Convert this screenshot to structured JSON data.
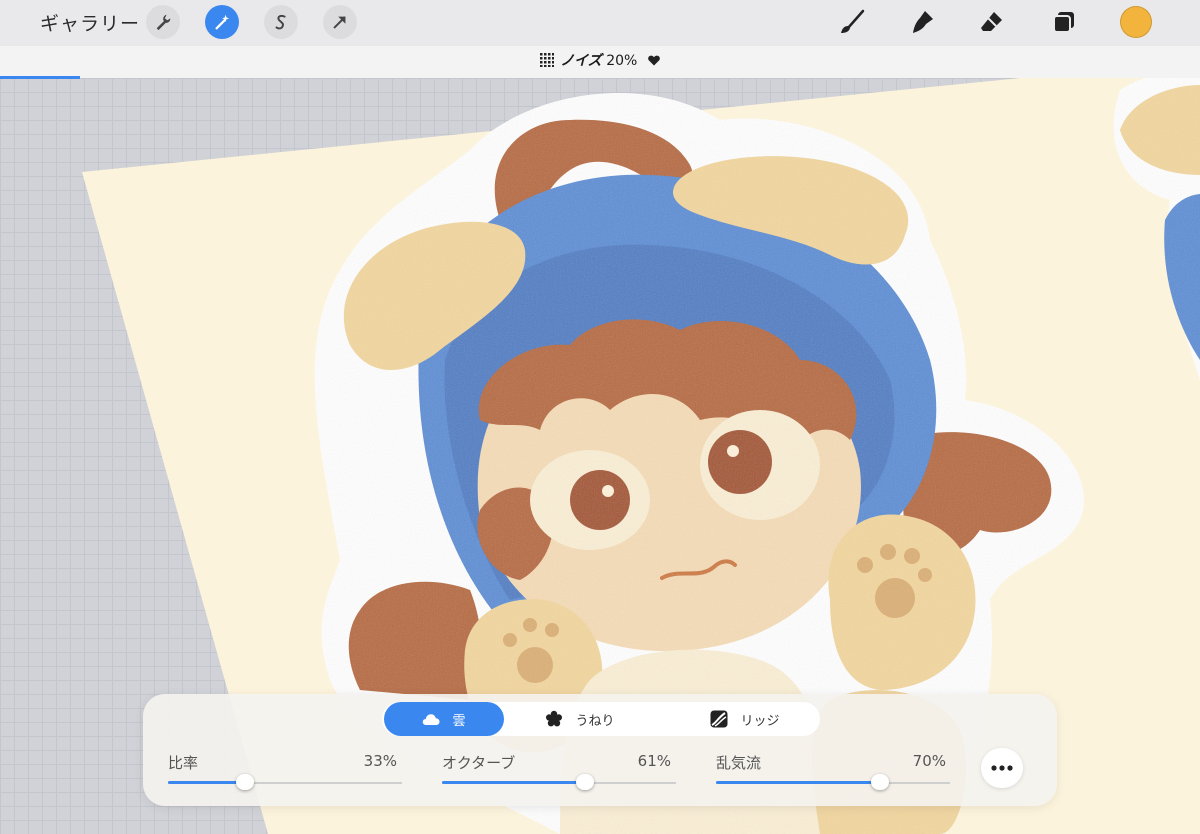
{
  "toolbar": {
    "gallery_label": "ギャラリー",
    "tools": [
      {
        "name": "wrench-icon",
        "active": false
      },
      {
        "name": "magic-wand-icon",
        "active": true
      },
      {
        "name": "selection-s-icon",
        "active": false
      },
      {
        "name": "transform-arrow-icon",
        "active": false
      }
    ],
    "right_tools": [
      "brush-icon",
      "smudge-icon",
      "eraser-icon",
      "layers-icon"
    ],
    "current_color": "#f2b43c"
  },
  "filter": {
    "icon": "noise-grid-icon",
    "name": "ノイズ",
    "value": "20%",
    "dropdown_icon": "heart-dropdown-icon",
    "progress": 0.067
  },
  "segments": [
    {
      "label": "雲",
      "icon": "cloud-icon",
      "active": true
    },
    {
      "label": "うねり",
      "icon": "billow-flower-icon",
      "active": false
    },
    {
      "label": "リッジ",
      "icon": "ridge-icon",
      "active": false
    }
  ],
  "sliders": [
    {
      "label": "比率",
      "value": "33%",
      "fraction": 0.33
    },
    {
      "label": "オクターブ",
      "value": "61%",
      "fraction": 0.61
    },
    {
      "label": "乱気流",
      "value": "70%",
      "fraction": 0.7
    }
  ],
  "more_icon": "more-ellipsis-icon",
  "colors": {
    "accent": "#3b87f0",
    "hood": "#5b8fd6",
    "hair": "#b86a3a",
    "skin": "#f6ddb8",
    "ears": "#f3d79f",
    "paper": "#fdf3dc"
  }
}
